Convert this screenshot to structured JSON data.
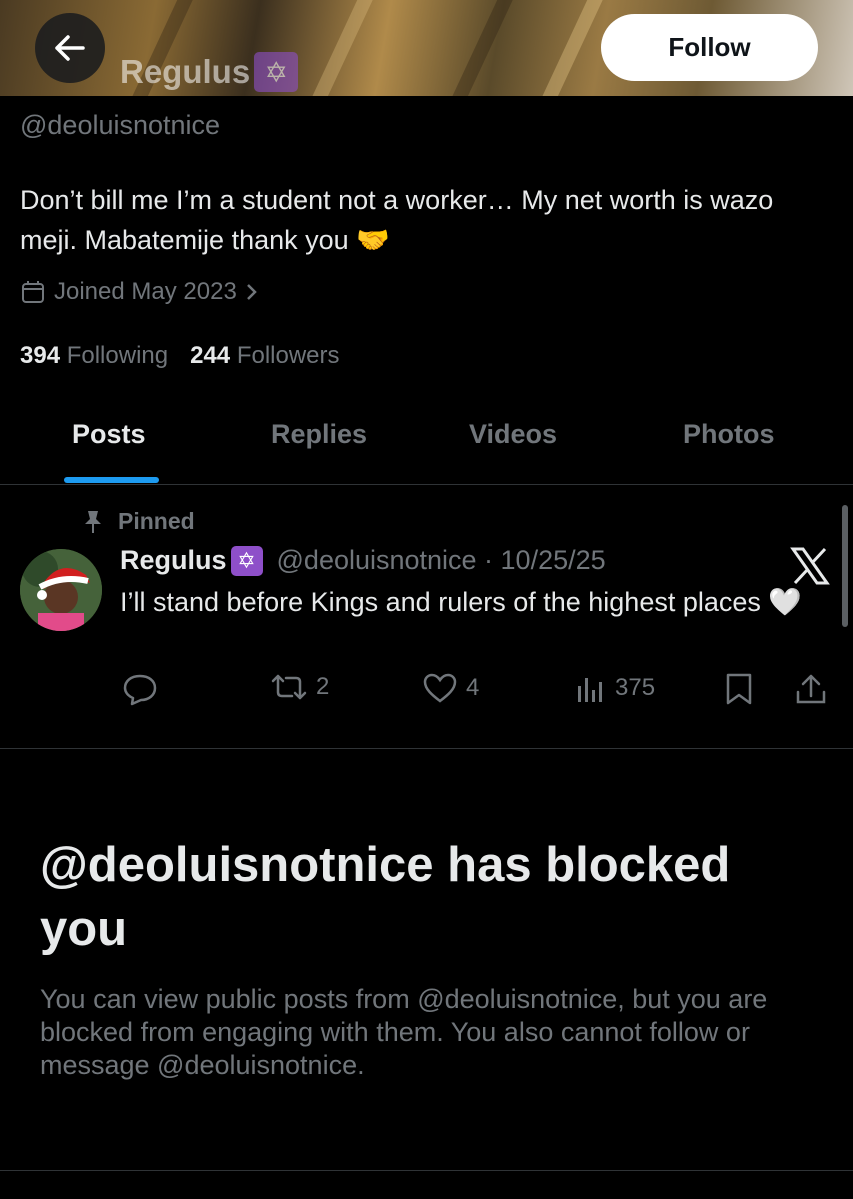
{
  "header": {
    "display_name": "Regulus",
    "badge_emoji": "✡",
    "follow_label": "Follow"
  },
  "profile": {
    "handle": "@deoluisnotnice",
    "bio": "Don’t bill me I’m a student not a worker… My net worth is wazo meji. Mabatemije thank you 🤝",
    "joined": "Joined May 2023",
    "following_count": "394",
    "following_label": "Following",
    "followers_count": "244",
    "followers_label": "Followers"
  },
  "tabs": [
    {
      "label": "Posts",
      "active": true
    },
    {
      "label": "Replies",
      "active": false
    },
    {
      "label": "Videos",
      "active": false
    },
    {
      "label": "Photos",
      "active": false
    }
  ],
  "pinned_post": {
    "pinned_label": "Pinned",
    "author_name": "Regulus",
    "badge_emoji": "✡",
    "handle_date": "@deoluisnotnice · 10/25/25",
    "text": "I’ll stand before Kings and rulers of the highest places 🤍",
    "retweets": "2",
    "likes": "4",
    "views": "375"
  },
  "blocked_notice": {
    "title": "@deoluisnotnice has blocked you",
    "description": "You can view public posts from @deoluisnotnice, but you are blocked from engaging with them. You also cannot follow or message @deoluisnotnice."
  },
  "colors": {
    "background": "#000000",
    "primary_text": "#e7e9ea",
    "secondary_text": "#71767b",
    "accent_blue": "#1d9bf0",
    "badge_purple": "#8e4fc9",
    "divider": "#2f3336"
  },
  "icons": [
    "back-arrow-icon",
    "calendar-icon",
    "chevron-right-icon",
    "pin-icon",
    "x-logo-icon",
    "reply-icon",
    "retweet-icon",
    "like-icon",
    "views-icon",
    "bookmark-icon",
    "share-icon"
  ]
}
